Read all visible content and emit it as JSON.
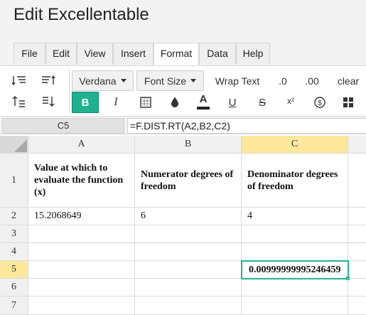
{
  "app": {
    "title": "Edit Excellentable"
  },
  "menu": {
    "tabs": [
      "File",
      "Edit",
      "View",
      "Insert",
      "Format",
      "Data",
      "Help"
    ],
    "active": "Format"
  },
  "toolbar": {
    "font": "Verdana",
    "font_size": "Font Size",
    "wrap_text": "Wrap Text",
    "dec_less": ".0",
    "dec_more": ".00",
    "clear": "clear",
    "bold": "B",
    "italic": "I",
    "font_color": "A",
    "underline": "U",
    "strike": "S",
    "superscript": "x²",
    "accent_color": "#1fb18f"
  },
  "formula_bar": {
    "cell_ref": "C5",
    "formula": "=F.DIST.RT(A2,B2,C2)"
  },
  "grid": {
    "columns": [
      "A",
      "B",
      "C"
    ],
    "selected_column": "C",
    "rows": [
      "1",
      "2",
      "3",
      "4",
      "5",
      "6",
      "7"
    ],
    "selected_row": "5",
    "cells": {
      "A1": "Value at which to evaluate the function (x)",
      "B1": "Numerator degrees of freedom",
      "C1": "Denominator degrees of freedom",
      "A2": "15.2068649",
      "B2": "6",
      "C2": "4",
      "C5": "0.00999999995246459"
    },
    "selection_color": "#22b38f"
  }
}
